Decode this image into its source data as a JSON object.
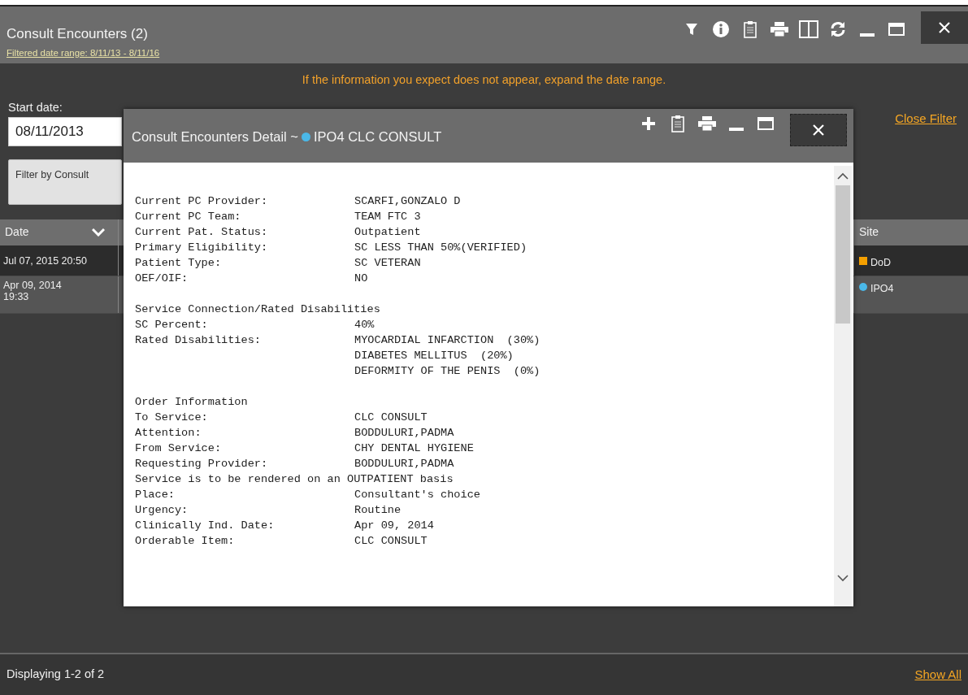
{
  "window": {
    "title": "Consult Encounters (2)",
    "filter_range": "Filtered date range: 8/11/13 - 8/11/16"
  },
  "message": "If the information you expect does not appear, expand the date range.",
  "start_date": {
    "label": "Start date:",
    "value": "08/11/2013"
  },
  "filter_button": "Filter by Consult",
  "close_filter": "Close Filter",
  "table": {
    "columns": [
      {
        "label": "Date",
        "sorted": true
      },
      {
        "label": "Site",
        "sorted": false
      }
    ],
    "rows": [
      {
        "date": "Jul 07, 2015 20:50",
        "site": "DoD",
        "kind": "square",
        "color": "#f5a000",
        "selected": false
      },
      {
        "date": "Apr 09, 2014 19:33",
        "site": "IPO4",
        "kind": "circle",
        "color": "#4ab8e8",
        "selected": true
      }
    ]
  },
  "footer": {
    "displaying": "Displaying 1-2 of 2",
    "show_all": "Show All"
  },
  "detail_dialog": {
    "title_prefix": "Consult Encounters Detail ~",
    "color": "#4ab8e8",
    "title": "IPO4 CLC CONSULT",
    "lines": [
      {
        "kind": "pair",
        "label": "Current PC Provider:",
        "value": "SCARFI,GONZALO D"
      },
      {
        "kind": "pair",
        "label": "Current PC Team:",
        "value": "TEAM FTC 3"
      },
      {
        "kind": "pair",
        "label": "Current Pat. Status:",
        "value": "Outpatient"
      },
      {
        "kind": "pair",
        "label": "Primary Eligibility:",
        "value": "SC LESS THAN 50%(VERIFIED)"
      },
      {
        "kind": "pair",
        "label": "Patient Type:",
        "value": "SC VETERAN"
      },
      {
        "kind": "pair",
        "label": "OEF/OIF:",
        "value": "NO"
      },
      {
        "kind": "blank"
      },
      {
        "kind": "heading",
        "label": "Service Connection/Rated Disabilities"
      },
      {
        "kind": "pair",
        "label": "SC Percent:",
        "value": "40%"
      },
      {
        "kind": "pair",
        "label": "Rated Disabilities:",
        "value": "MYOCARDIAL INFARCTION  (30%)"
      },
      {
        "kind": "pair",
        "value": "DIABETES MELLITUS  (20%)"
      },
      {
        "kind": "pair",
        "value": "DEFORMITY OF THE PENIS  (0%)"
      },
      {
        "kind": "blank"
      },
      {
        "kind": "heading",
        "label": "Order Information"
      },
      {
        "kind": "pair",
        "label": "To Service:",
        "value": "CLC CONSULT"
      },
      {
        "kind": "pair",
        "label": "Attention:",
        "value": "BODDULURI,PADMA"
      },
      {
        "kind": "pair",
        "label": "From Service:",
        "value": "CHY DENTAL HYGIENE"
      },
      {
        "kind": "pair",
        "label": "Requesting Provider:",
        "value": "BODDULURI,PADMA"
      },
      {
        "kind": "heading",
        "label": "Service is to be rendered on an OUTPATIENT basis"
      },
      {
        "kind": "pair",
        "label": "Place:",
        "value": "Consultant's choice"
      },
      {
        "kind": "pair",
        "label": "Urgency:",
        "value": "Routine"
      },
      {
        "kind": "pair",
        "label": "Clinically Ind. Date:",
        "value": "Apr 09, 2014"
      },
      {
        "kind": "pair",
        "label": "Orderable Item:",
        "value": "CLC CONSULT"
      }
    ]
  }
}
